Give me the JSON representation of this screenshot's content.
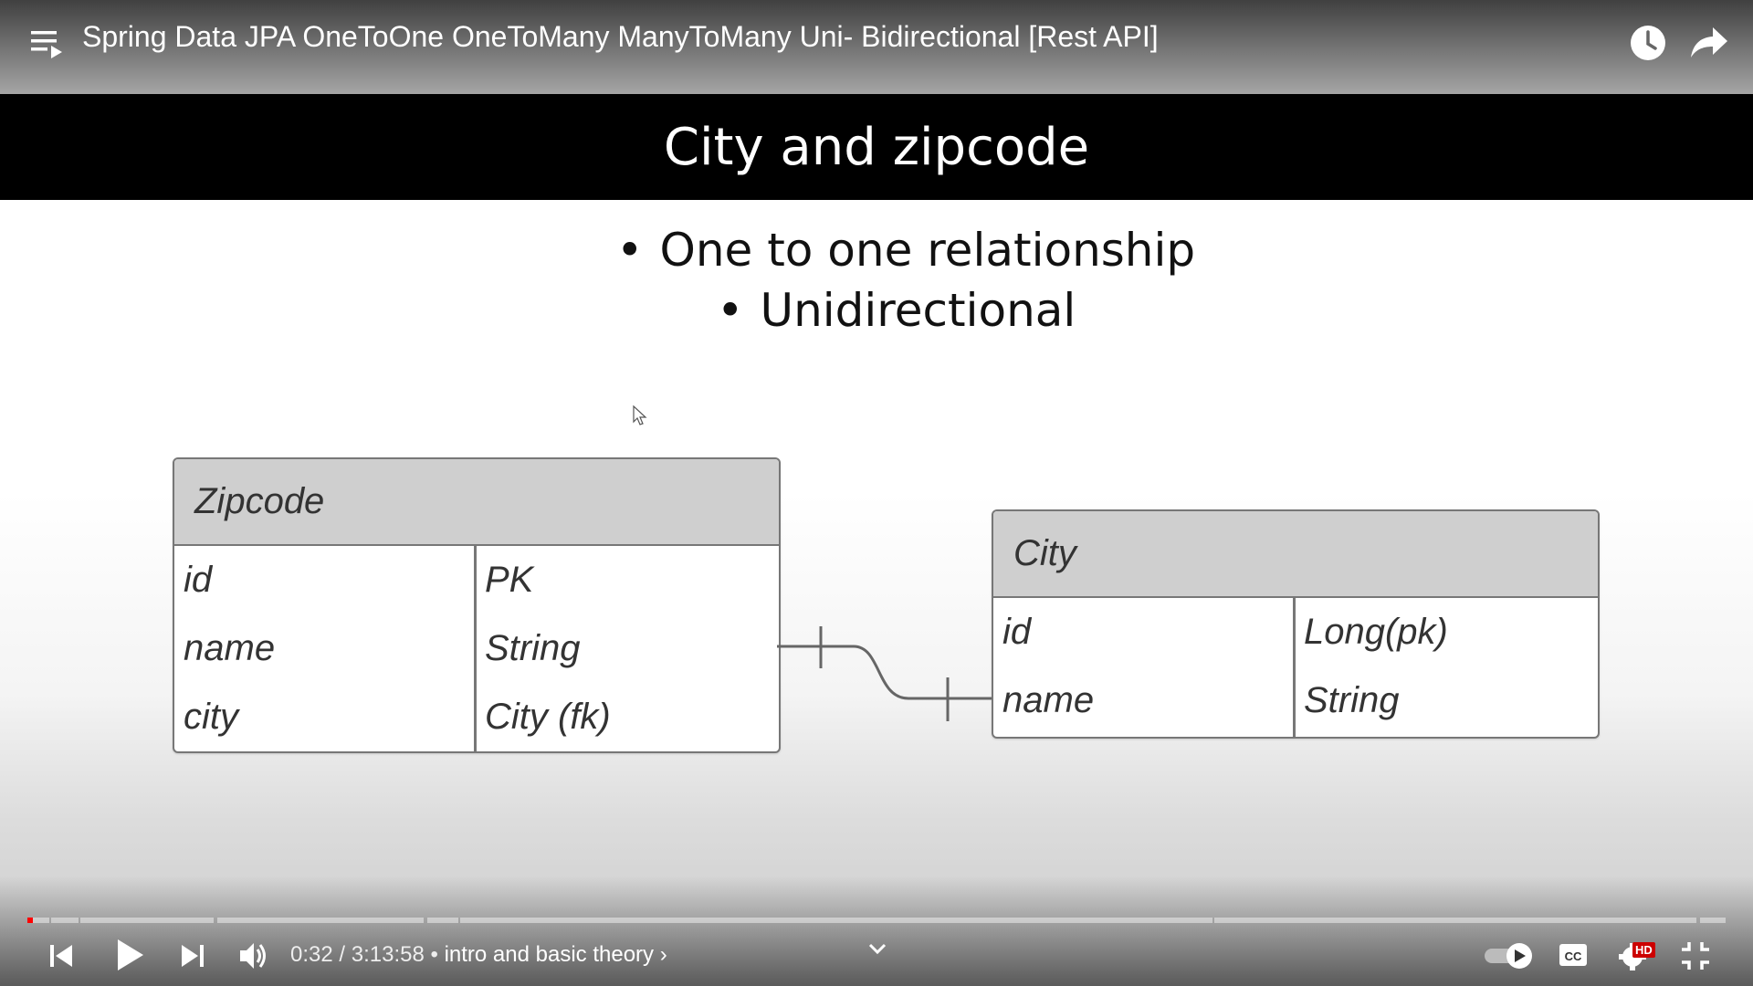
{
  "video": {
    "title": "Spring Data JPA OneToOne OneToMany ManyToMany Uni- Bidirectional [Rest API]",
    "current_time": "0:32",
    "duration": "3:13:58",
    "chapter": "intro and basic theory",
    "progress": 0.003,
    "settings_badge": "HD"
  },
  "slide": {
    "title": "City and zipcode",
    "bullets": [
      "One to one relationship",
      "Unidirectional"
    ],
    "entities": [
      {
        "name": "Zipcode",
        "fields": [
          {
            "name": "id",
            "type": "PK"
          },
          {
            "name": "name",
            "type": "String"
          },
          {
            "name": "city",
            "type": "City (fk)"
          }
        ]
      },
      {
        "name": "City",
        "fields": [
          {
            "name": "id",
            "type": "Long(pk)"
          },
          {
            "name": "name",
            "type": "String"
          }
        ]
      }
    ]
  },
  "icons": {
    "playlist": "playlist-icon",
    "watch_later": "clock-icon",
    "share": "share-icon",
    "prev": "skip-previous-icon",
    "play": "play-icon",
    "next": "skip-next-icon",
    "volume": "volume-icon",
    "autoplay": "autoplay-toggle-icon",
    "cc": "captions-icon",
    "settings": "gear-icon",
    "fullscreen": "exit-fullscreen-icon",
    "chapters_chevron": "chevron-down-icon"
  },
  "colors": {
    "progress": "#ff0000",
    "hd_badge": "#cc0000"
  }
}
